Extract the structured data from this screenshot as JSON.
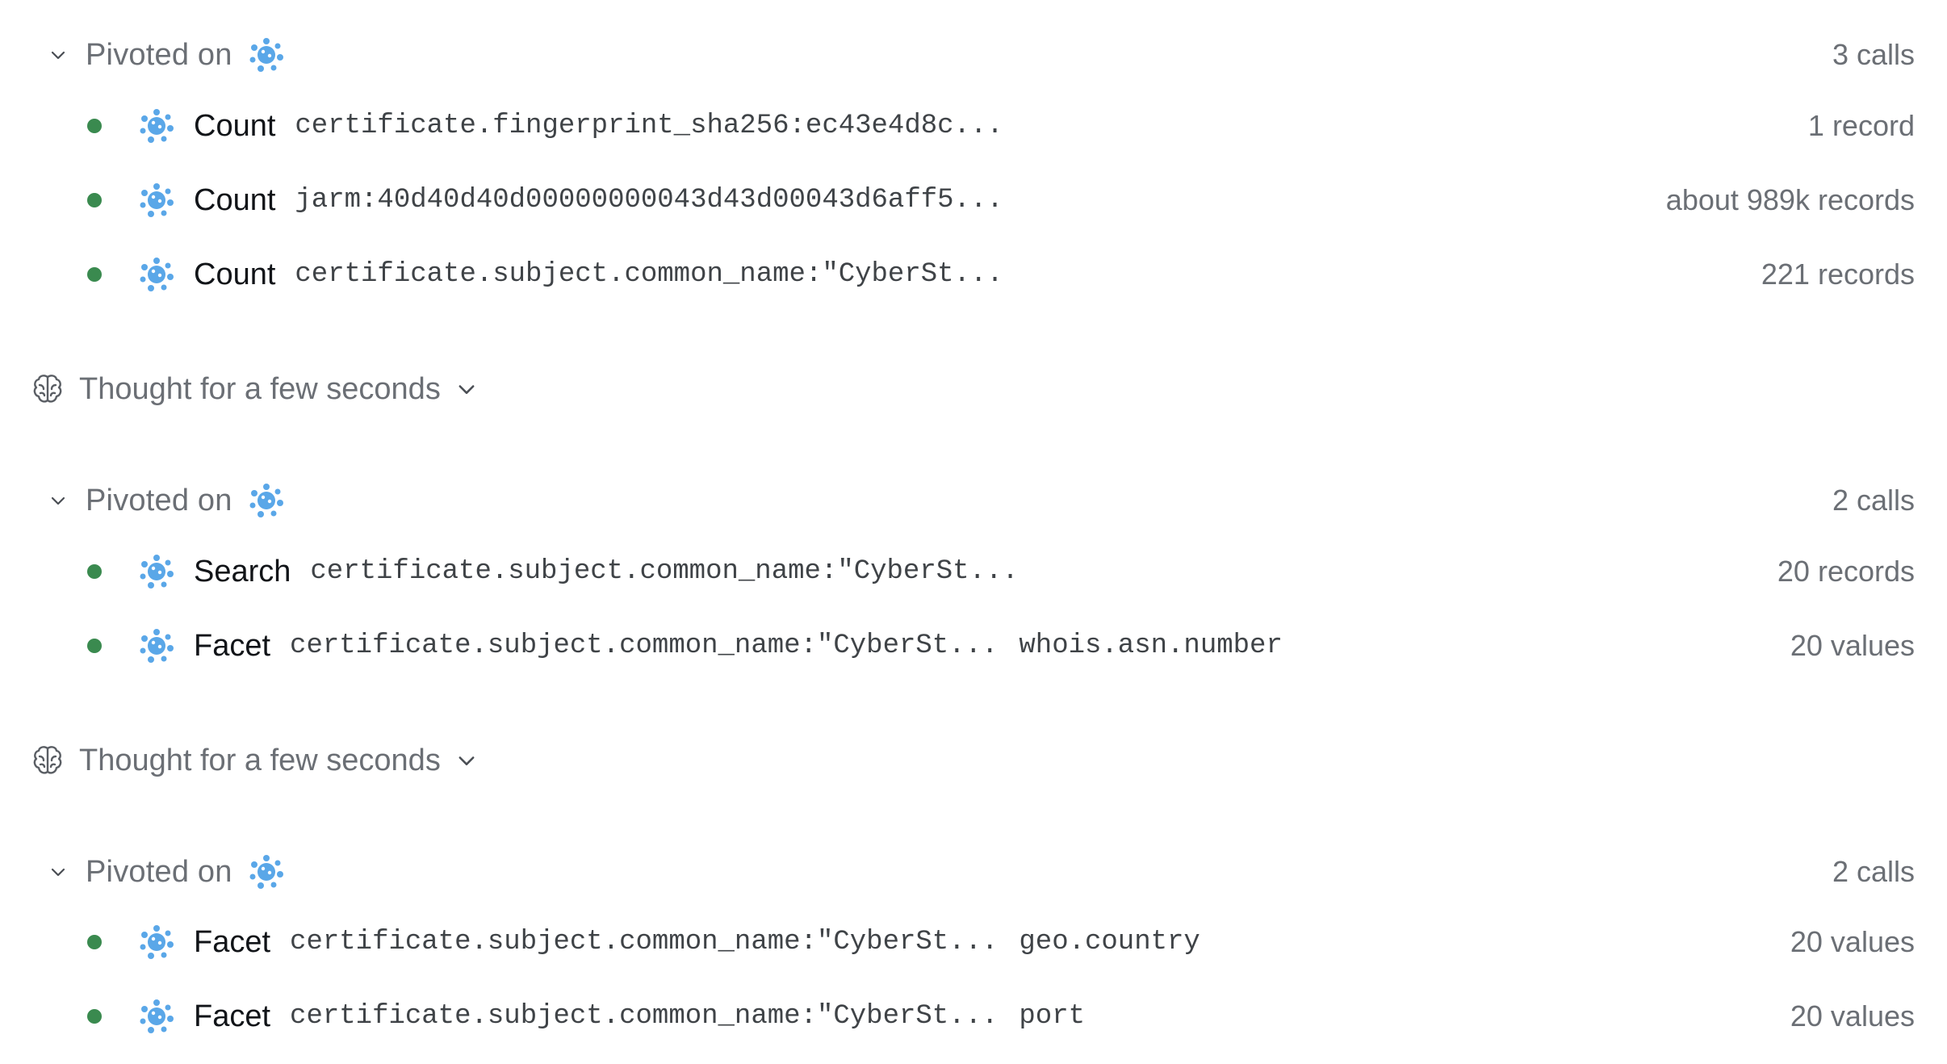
{
  "groups": [
    {
      "title": "Pivoted on",
      "count": "3 calls",
      "rows": [
        {
          "action": "Count",
          "query": "certificate.fingerprint_sha256:ec43e4d8c...",
          "field": "",
          "result": "1 record"
        },
        {
          "action": "Count",
          "query": "jarm:40d40d40d00000000043d43d00043d6aff5...",
          "field": "",
          "result": "about 989k records"
        },
        {
          "action": "Count",
          "query": "certificate.subject.common_name:\"CyberSt...",
          "field": "",
          "result": "221 records"
        }
      ]
    },
    {
      "title": "Pivoted on",
      "count": "2 calls",
      "rows": [
        {
          "action": "Search",
          "query": "certificate.subject.common_name:\"CyberSt...",
          "field": "",
          "result": "20 records"
        },
        {
          "action": "Facet",
          "query": "certificate.subject.common_name:\"CyberSt...",
          "field": "whois.asn.number",
          "result": "20 values"
        }
      ]
    },
    {
      "title": "Pivoted on",
      "count": "2 calls",
      "rows": [
        {
          "action": "Facet",
          "query": "certificate.subject.common_name:\"CyberSt...",
          "field": "geo.country",
          "result": "20 values"
        },
        {
          "action": "Facet",
          "query": "certificate.subject.common_name:\"CyberSt...",
          "field": "port",
          "result": "20 values"
        }
      ]
    }
  ],
  "thoughts": [
    {
      "label": "Thought for a few seconds"
    },
    {
      "label": "Thought for a few seconds"
    }
  ],
  "colors": {
    "status_dot": "#3a8a4f",
    "logo": "#5aa7e8",
    "muted_text": "#6b6f75"
  },
  "icons": {
    "group_toggle": "chevron-down-icon",
    "source_logo": "splat-logo-icon",
    "thought": "brain-icon",
    "thought_toggle": "chevron-down-icon"
  }
}
